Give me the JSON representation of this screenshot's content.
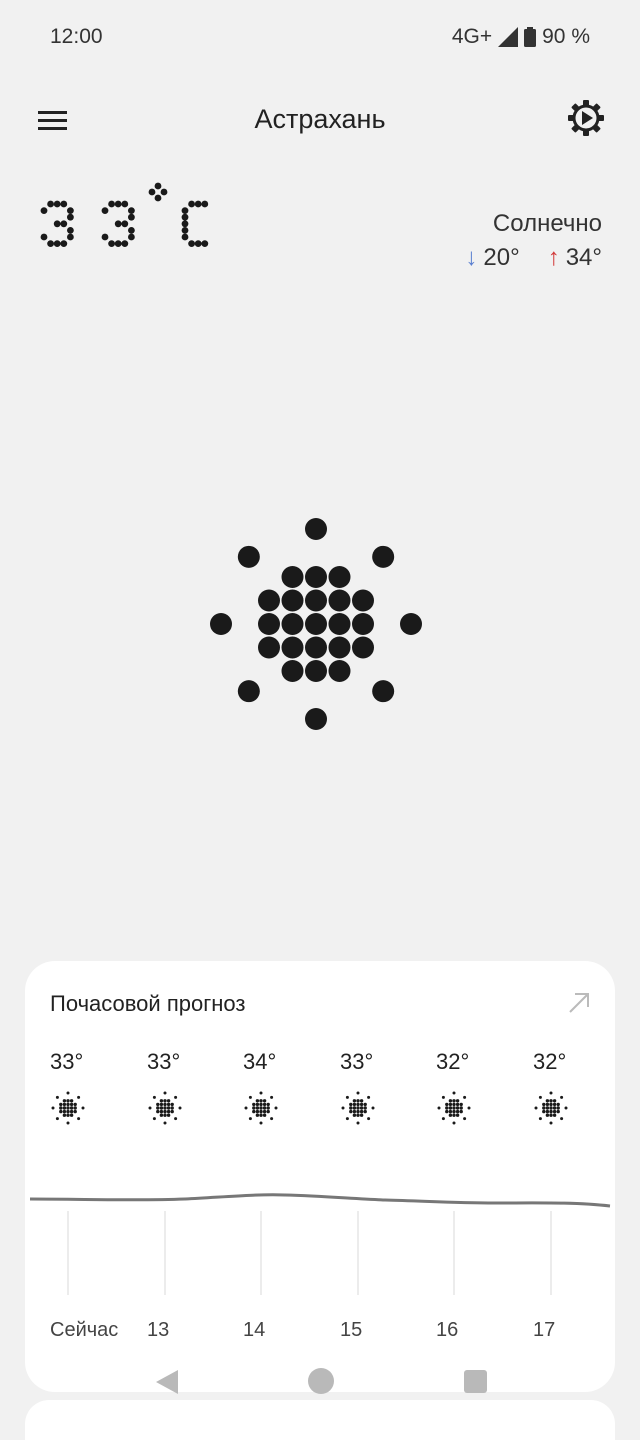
{
  "status_bar": {
    "time": "12:00",
    "network": "4G+",
    "battery": "90 %"
  },
  "header": {
    "city": "Астрахань",
    "menu_icon": "hamburger-menu-icon",
    "settings_icon": "gear-settings-icon"
  },
  "current": {
    "temperature": "33°C",
    "condition": "Солнечно",
    "low": "20°",
    "high": "34°",
    "icon": "sun-icon"
  },
  "hourly": {
    "title": "Почасовой прогноз",
    "expand_icon": "arrow-up-right-icon",
    "hours": [
      {
        "temp": "33°",
        "label": "Сейчас",
        "icon": "sun-icon"
      },
      {
        "temp": "33°",
        "label": "13",
        "icon": "sun-icon"
      },
      {
        "temp": "34°",
        "label": "14",
        "icon": "sun-icon"
      },
      {
        "temp": "33°",
        "label": "15",
        "icon": "sun-icon"
      },
      {
        "temp": "32°",
        "label": "16",
        "icon": "sun-icon"
      },
      {
        "temp": "32°",
        "label": "17",
        "icon": "sun-icon"
      }
    ]
  },
  "nav": {
    "back_icon": "triangle-back-icon",
    "home_icon": "circle-home-icon",
    "recents_icon": "square-recents-icon"
  }
}
